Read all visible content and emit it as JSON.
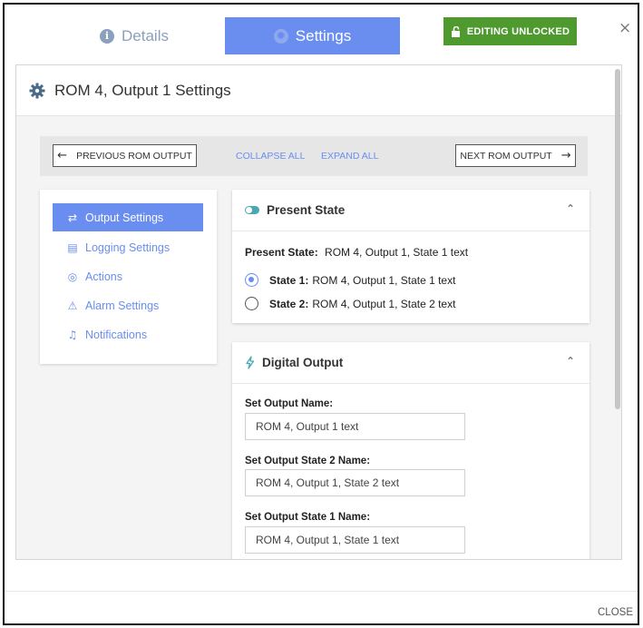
{
  "tabs": {
    "details": "Details",
    "settings": "Settings"
  },
  "unlock_button": "EDITING UNLOCKED",
  "close_x": "×",
  "panel": {
    "title": "ROM 4, Output 1 Settings"
  },
  "toolbar": {
    "previous": "PREVIOUS ROM OUTPUT",
    "collapse_all": "COLLAPSE ALL",
    "expand_all": "EXPAND ALL",
    "next": "NEXT ROM OUTPUT"
  },
  "nav": {
    "items": [
      {
        "label": "Output Settings",
        "icon": "output-icon"
      },
      {
        "label": "Logging Settings",
        "icon": "clipboard-icon"
      },
      {
        "label": "Actions",
        "icon": "target-icon"
      },
      {
        "label": "Alarm Settings",
        "icon": "alarm-icon"
      },
      {
        "label": "Notifications",
        "icon": "bell-icon"
      }
    ]
  },
  "present_state": {
    "heading": "Present State",
    "label": "Present State:",
    "value": "ROM 4, Output 1, State 1 text",
    "options": [
      {
        "label": "State 1:",
        "text": "ROM 4, Output 1, State 1 text",
        "selected": true
      },
      {
        "label": "State 2:",
        "text": "ROM 4, Output 1, State 2 text",
        "selected": false
      }
    ]
  },
  "digital_output": {
    "heading": "Digital Output",
    "fields": [
      {
        "label": "Set Output Name:",
        "value": "ROM 4, Output 1 text"
      },
      {
        "label": "Set Output State 2 Name:",
        "value": "ROM 4, Output 1, State 2 text"
      },
      {
        "label": "Set Output State 1 Name:",
        "value": "ROM 4, Output 1, State 1 text"
      }
    ]
  },
  "footer": {
    "close": "CLOSE"
  },
  "colors": {
    "accent": "#6a8ef0",
    "unlock_green": "#4e9a2e",
    "toggle_teal": "#4aa8b3"
  }
}
